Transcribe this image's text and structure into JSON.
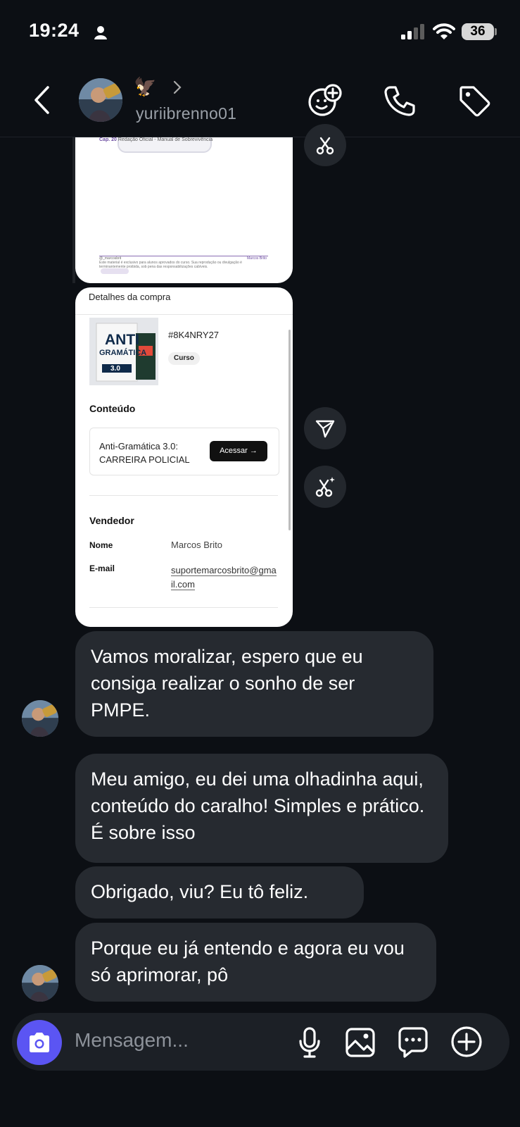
{
  "status_bar": {
    "time": "19:24",
    "battery": "36"
  },
  "header": {
    "username": "yuriibrenno01",
    "emoji": "🦅",
    "icons": [
      "back-chevron-icon",
      "avatar-sticker-icon",
      "phone-icon",
      "tag-icon"
    ]
  },
  "doc_preview": {
    "caption_left": "Cap. 20",
    "caption_mid": "Redação Oficial - Manual de Sobrevivência",
    "footer_left": "@_marcosbrit",
    "footer_right": "Marcos Brito",
    "footer_text": "Este material é exclusivo para alunos aprovados do curso. Sua reprodução ou divulgação é terminantemente proibida, sob pena das responsabilizações cabíveis."
  },
  "purchase": {
    "title": "Detalhes da compra",
    "order_code": "#8K4NRY27",
    "tag": "Curso",
    "cover_text_1": "ANTI",
    "cover_text_2": "GRAMÁTICA",
    "cover_text_3": "3.0",
    "content_heading": "Conteúdo",
    "product_name": "Anti-Gramática 3.0: CARREIRA POLICIAL",
    "access_button": "Acessar",
    "seller_heading": "Vendedor",
    "name_label": "Nome",
    "name_value": "Marcos Brito",
    "email_label": "E-mail",
    "email_value": "suportemarcosbrito@gmail.com"
  },
  "messages": [
    {
      "text": "Vamos moralizar, espero que eu consiga realizar o sonho de ser PMPE."
    },
    {
      "text": "Meu amigo, eu dei uma olhadinha aqui, conteúdo do caralho! Simples e prático. É sobre isso"
    },
    {
      "text": "Obrigado, viu? Eu tô feliz."
    },
    {
      "text": "Porque eu já entendo e agora eu vou só aprimorar, pô"
    }
  ],
  "composer": {
    "placeholder": "Mensagem...",
    "icons": [
      "camera-icon",
      "microphone-icon",
      "gallery-icon",
      "chat-bubble-icon",
      "plus-circle-icon"
    ]
  },
  "colors": {
    "background": "#0c0f14",
    "bubble": "#262a30",
    "camera_button": "#5b55f3"
  }
}
